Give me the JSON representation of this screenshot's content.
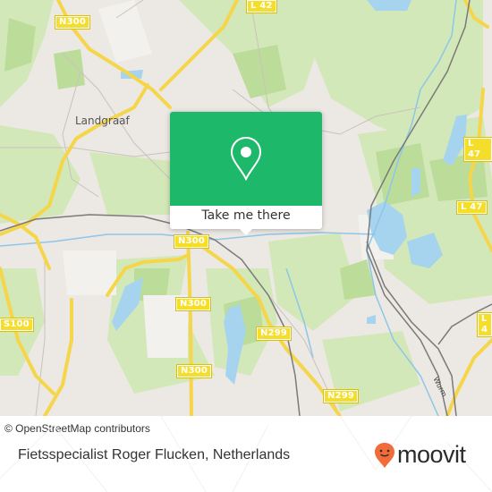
{
  "map": {
    "place_labels": [
      {
        "name": "landgraaf",
        "text": "Landgraaf"
      }
    ],
    "road_shields": [
      {
        "id": "n300-top",
        "text": "N300"
      },
      {
        "id": "l42",
        "text": "L 42"
      },
      {
        "id": "l47-a",
        "text": "L 47"
      },
      {
        "id": "l47-b",
        "text": "L 47"
      },
      {
        "id": "n300-mid",
        "text": "N300"
      },
      {
        "id": "n300-b",
        "text": "N300"
      },
      {
        "id": "n300-c",
        "text": "N300"
      },
      {
        "id": "s100",
        "text": "S100"
      },
      {
        "id": "n299-a",
        "text": "N299"
      },
      {
        "id": "n299-b",
        "text": "N299"
      },
      {
        "id": "l4-edge",
        "text": "L 4"
      }
    ],
    "river_label": "Wurm",
    "colors": {
      "land": "#ece8e4",
      "green": "#cfe6b0",
      "green_dark": "#b9dc96",
      "water": "#a6d4ee",
      "road": "#f7dc5a",
      "rail": "#777777"
    }
  },
  "popup": {
    "icon": "location-pin-icon",
    "button_label": "Take me there",
    "color": "#1db86a"
  },
  "attribution": "© OpenStreetMap contributors",
  "footer": {
    "title": "Fietsspecialist Roger Flucken, Netherlands",
    "brand": "moovit",
    "brand_icon": "moovit-logo-icon",
    "brand_color": "#f26b38"
  }
}
